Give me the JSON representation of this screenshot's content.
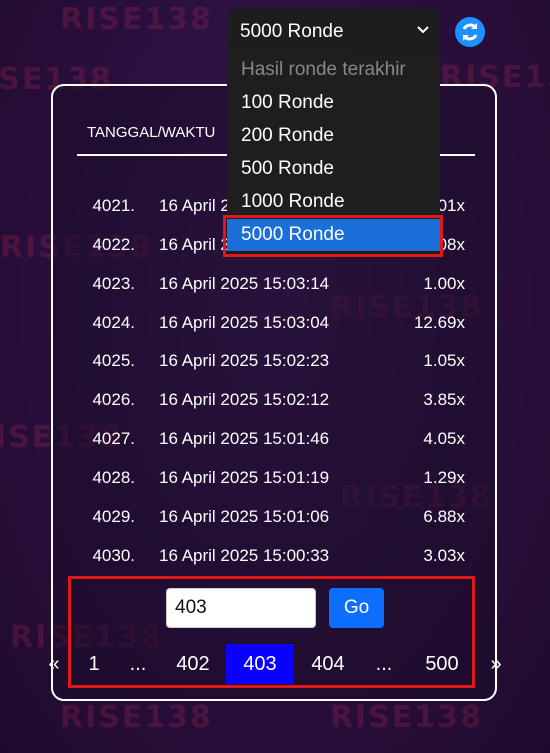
{
  "watermark_text": "RISE138",
  "round_select": {
    "value": "5000 Ronde",
    "options": [
      "Hasil ronde terakhir",
      "100 Ronde",
      "200 Ronde",
      "500 Ronde",
      "1000 Ronde",
      "5000 Ronde"
    ]
  },
  "table": {
    "header_date": "TANGGAL/WAKTU",
    "rows": [
      {
        "num": "4021.",
        "date": "16 April 2025 15:03:47",
        "mult": "1.01x"
      },
      {
        "num": "4022.",
        "date": "16 April 2025 15:03:34",
        "mult": "1.08x"
      },
      {
        "num": "4023.",
        "date": "16 April 2025 15:03:14",
        "mult": "1.00x"
      },
      {
        "num": "4024.",
        "date": "16 April 2025 15:03:04",
        "mult": "12.69x"
      },
      {
        "num": "4025.",
        "date": "16 April 2025 15:02:23",
        "mult": "1.05x"
      },
      {
        "num": "4026.",
        "date": "16 April 2025 15:02:12",
        "mult": "3.85x"
      },
      {
        "num": "4027.",
        "date": "16 April 2025 15:01:46",
        "mult": "4.05x"
      },
      {
        "num": "4028.",
        "date": "16 April 2025 15:01:19",
        "mult": "1.29x"
      },
      {
        "num": "4029.",
        "date": "16 April 2025 15:01:06",
        "mult": "6.88x"
      },
      {
        "num": "4030.",
        "date": "16 April 2025 15:00:33",
        "mult": "3.03x"
      }
    ]
  },
  "pagination": {
    "input_value": "403",
    "go_label": "Go",
    "prev": "«",
    "next": "»",
    "pages": [
      "1",
      "...",
      "402",
      "403",
      "404",
      "...",
      "500"
    ],
    "active_page": "403"
  },
  "colors": {
    "accent": "#0d6efd",
    "active_page": "#0a00ff",
    "highlight_border": "#e01818",
    "selected_option": "#1a6fd8"
  }
}
